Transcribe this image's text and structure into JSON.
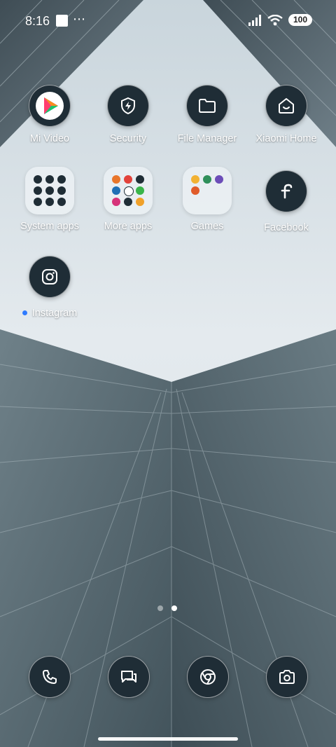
{
  "status": {
    "time": "8:16",
    "battery": "100",
    "icons": [
      "notification-square-icon",
      "more-dots-icon",
      "signal-icon",
      "wifi-icon",
      "battery-icon"
    ]
  },
  "apps": [
    {
      "label": "Mi Video",
      "icon": "play-triangle-icon"
    },
    {
      "label": "Security",
      "icon": "shield-bolt-icon"
    },
    {
      "label": "File Manager",
      "icon": "folder-icon"
    },
    {
      "label": "Xiaomi Home",
      "icon": "home-smile-icon"
    },
    {
      "label": "System apps",
      "icon": "folder-grid-icon"
    },
    {
      "label": "More apps",
      "icon": "folder-grid-icon"
    },
    {
      "label": "Games",
      "icon": "folder-grid-icon"
    },
    {
      "label": "Facebook",
      "icon": "facebook-f-icon"
    },
    {
      "label": "Instagram",
      "icon": "instagram-camera-icon"
    }
  ],
  "dock": [
    {
      "icon": "phone-icon"
    },
    {
      "icon": "messages-icon"
    },
    {
      "icon": "chrome-icon"
    },
    {
      "icon": "camera-icon"
    }
  ],
  "pager": {
    "pages": 2,
    "current": 2
  },
  "colors": {
    "icon_bg": "#1f2d36",
    "accent_dot": "#2f7bff"
  }
}
